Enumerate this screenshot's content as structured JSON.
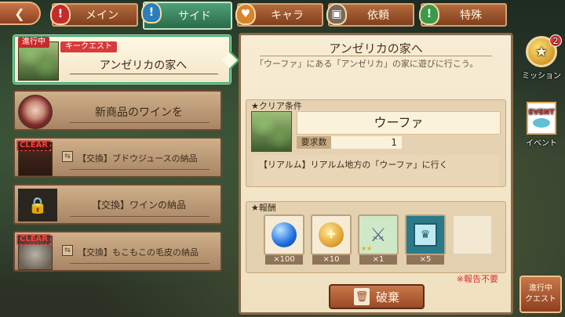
{
  "tabs": [
    {
      "label": "メイン",
      "icon": "!",
      "color": "#c42c2c"
    },
    {
      "label": "サイド",
      "icon": "!",
      "color": "#2a7fb8"
    },
    {
      "label": "キャラ",
      "icon": "♥",
      "color": "#d8842a"
    },
    {
      "label": "依頼",
      "icon": "▣",
      "color": "#7a6a5a"
    },
    {
      "label": "特殊",
      "icon": "!",
      "color": "#3a9a4a"
    }
  ],
  "quests": [
    {
      "status": "進行中",
      "tag": "キークエスト",
      "title": "アンゼリカの家へ"
    },
    {
      "title": "新商品のワインを"
    },
    {
      "clear": "CLEAR",
      "title": "【交換】ブドウジュースの納品"
    },
    {
      "title": "【交換】ワインの納品"
    },
    {
      "clear": "CLEAR",
      "title": "【交換】もこもこの毛皮の納品"
    }
  ],
  "detail": {
    "title": "アンゼリカの家へ",
    "description": "「ウーファ」にある「アンゼリカ」の家に遊びに行こう。",
    "condition_label": "★クリア条件",
    "location": "ウーファ",
    "req_label": "要求数",
    "req_value": "1",
    "condition_text": "【リアルム】リアルム地方の「ウーファ」に行く",
    "reward_label": "★報酬",
    "rewards": [
      {
        "icon": "blue-orb-icon",
        "qty": "×100"
      },
      {
        "icon": "gold-coin-icon",
        "qty": "×10"
      },
      {
        "icon": "sword-icon",
        "qty": "×1"
      },
      {
        "icon": "crown-ticket-icon",
        "qty": "×5"
      }
    ],
    "note": "※報告不要",
    "discard_label": "破棄"
  },
  "side": {
    "mission_label": "ミッション",
    "mission_badge": "2",
    "event_label": "イベント",
    "event_card_text": "EVENT",
    "inprogress_label": "進行中\nクエスト"
  }
}
